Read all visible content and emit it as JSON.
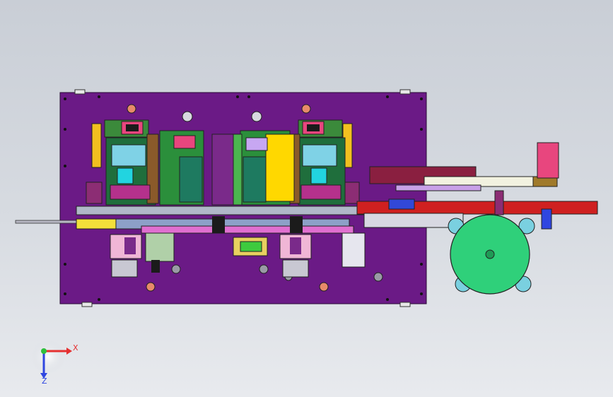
{
  "viewport": {
    "background_top": "#c9ced6",
    "background_bottom": "#e8eaee"
  },
  "assembly": {
    "base_plate_color": "#6b1a86",
    "drive_wheel_color": "#2fd07a",
    "motor_color": "#e8467e"
  },
  "triad": {
    "x_label": "X",
    "z_label": "Z",
    "x_color": "#e53030",
    "y_color": "#2fbf3c",
    "z_color": "#2f46e0"
  }
}
